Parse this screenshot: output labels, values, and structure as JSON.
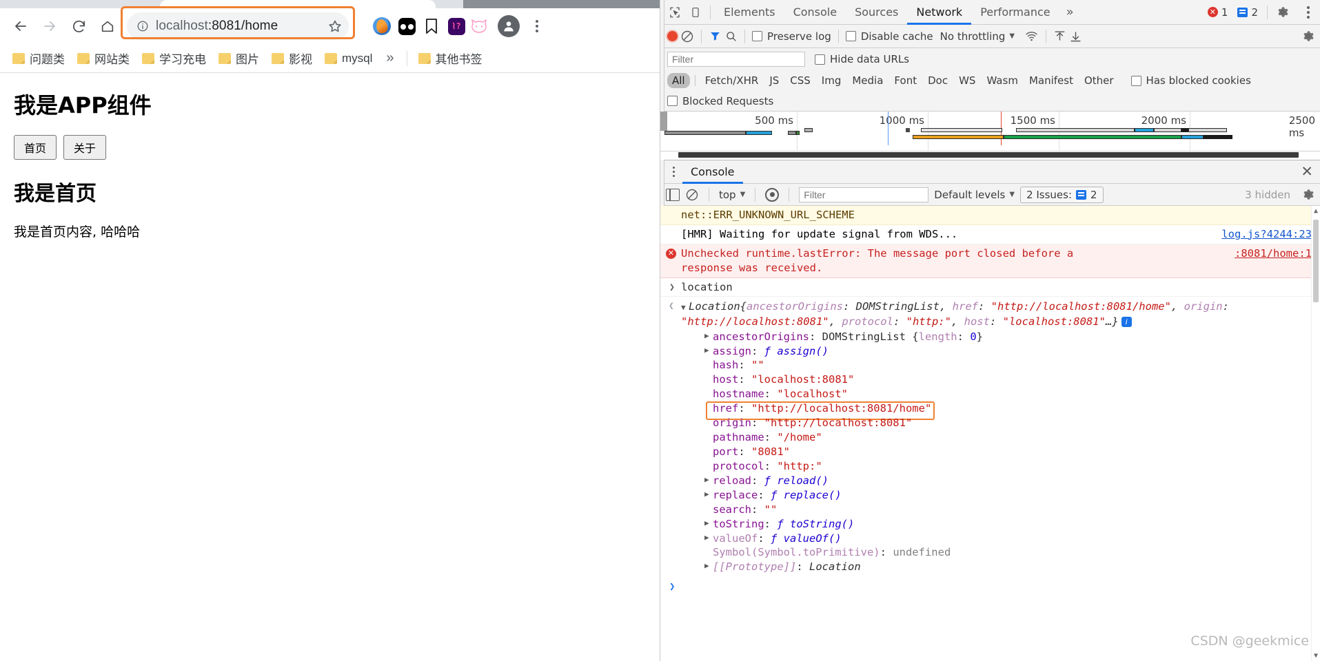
{
  "browser": {
    "nav": {
      "back": "back-arrow",
      "forward": "forward-arrow",
      "reload": "reload",
      "home": "home"
    },
    "omnibox": {
      "url_prefix": "localhost",
      "url_suffix": ":8081/home",
      "full_url": "localhost:8081/home",
      "highlight_color": "#f08030",
      "info_icon": "site-info-icon",
      "star_icon": "bookmark-star-icon"
    },
    "extensions": [
      "fire-extension-icon",
      "pocket-extension-icon",
      "bookmark-extension-icon",
      "purple-extension-icon",
      "cat-extension-icon"
    ],
    "bookmarks": [
      {
        "label": "问题类"
      },
      {
        "label": "网站类"
      },
      {
        "label": "学习充电"
      },
      {
        "label": "图片"
      },
      {
        "label": "影视"
      },
      {
        "label": "mysql"
      }
    ],
    "bookmarks_overflow": "»",
    "other_bookmarks": "其他书签",
    "page": {
      "title": "我是APP组件",
      "buttons": [
        "首页",
        "关于"
      ],
      "heading": "我是首页",
      "body": "我是首页内容, 哈哈哈"
    }
  },
  "devtools": {
    "tabs": [
      {
        "label": "Elements",
        "active": false
      },
      {
        "label": "Console",
        "active": false
      },
      {
        "label": "Sources",
        "active": false
      },
      {
        "label": "Network",
        "active": true
      },
      {
        "label": "Performance",
        "active": false
      }
    ],
    "more_tabs": "»",
    "error_count": "1",
    "message_count": "2",
    "network_toolbar": {
      "record": "record-button",
      "clear": "clear-button",
      "filter_icon": "funnel-icon",
      "search_icon": "search-icon",
      "preserve_log": "Preserve log",
      "disable_cache": "Disable cache",
      "throttling": "No throttling",
      "upload_icon": "import-har-icon",
      "download_icon": "export-har-icon",
      "settings_icon": "gear-icon"
    },
    "filter": {
      "placeholder": "Filter",
      "value": "",
      "hide_data_urls": "Hide data URLs",
      "has_blocked_cookies": "Has blocked cookies",
      "blocked_requests": "Blocked Requests"
    },
    "resource_types": [
      "All",
      "Fetch/XHR",
      "JS",
      "CSS",
      "Img",
      "Media",
      "Font",
      "Doc",
      "WS",
      "Wasm",
      "Manifest",
      "Other"
    ],
    "active_resource_type": "All",
    "overview": {
      "ticks": [
        "500 ms",
        "1000 ms",
        "1500 ms",
        "2000 ms",
        "2500 ms"
      ]
    },
    "drawer": {
      "tab": "Console",
      "close": "close-icon",
      "toolbar": {
        "sidebar_toggle": "console-sidebar-icon",
        "clear": "clear-console-icon",
        "context": "top",
        "eye": "live-expression-icon",
        "filter_placeholder": "Filter",
        "filter_value": "",
        "levels": "Default levels",
        "issues": "2 Issues:",
        "issues_count": "2",
        "hidden": "3 hidden",
        "settings": "gear-icon"
      },
      "messages": [
        {
          "kind": "warn",
          "text": "net::ERR_UNKNOWN_URL_SCHEME",
          "source": ""
        },
        {
          "kind": "info",
          "text": "[HMR] Waiting for update signal from WDS...",
          "source": "log.js?4244:23"
        },
        {
          "kind": "err",
          "text": "Unchecked runtime.lastError: The message port closed before a response was received.",
          "source": ":8081/home:1"
        }
      ],
      "evaluated": "location",
      "result_preview": {
        "class": "Location",
        "open_brace": "{",
        "parts": [
          {
            "key": "ancestorOrigins",
            "value": "DOMStringList",
            "type": "cls"
          },
          {
            "key": "href",
            "value": "\"http://localhost:8081/home\"",
            "type": "str"
          },
          {
            "key": "origin",
            "value": "\"http://localhost:8081\"",
            "type": "str"
          },
          {
            "key": "protocol",
            "value": "\"http:\"",
            "type": "str"
          },
          {
            "key": "host",
            "value": "\"localhost:8081\"",
            "type": "str"
          }
        ],
        "ellipsis": "…}",
        "info_badge": "i"
      },
      "properties": [
        {
          "tri": true,
          "key": "ancestorOrigins",
          "sep": ": ",
          "value": "DOMStringList {length: 0}",
          "vtype": "cls-num",
          "dim": false
        },
        {
          "tri": true,
          "key": "assign",
          "sep": ": ",
          "value": "ƒ assign()",
          "vtype": "fn",
          "dim": false
        },
        {
          "tri": false,
          "key": "hash",
          "sep": ": ",
          "value": "\"\"",
          "vtype": "str",
          "dim": false
        },
        {
          "tri": false,
          "key": "host",
          "sep": ": ",
          "value": "\"localhost:8081\"",
          "vtype": "str",
          "dim": false
        },
        {
          "tri": false,
          "key": "hostname",
          "sep": ": ",
          "value": "\"localhost\"",
          "vtype": "str",
          "dim": false
        },
        {
          "tri": false,
          "key": "href",
          "sep": ": ",
          "value": "\"http://localhost:8081/home\"",
          "vtype": "str",
          "dim": false,
          "highlight": true
        },
        {
          "tri": false,
          "key": "origin",
          "sep": ": ",
          "value": "\"http://localhost:8081\"",
          "vtype": "str",
          "dim": false
        },
        {
          "tri": false,
          "key": "pathname",
          "sep": ": ",
          "value": "\"/home\"",
          "vtype": "str",
          "dim": false
        },
        {
          "tri": false,
          "key": "port",
          "sep": ": ",
          "value": "\"8081\"",
          "vtype": "str",
          "dim": false
        },
        {
          "tri": false,
          "key": "protocol",
          "sep": ": ",
          "value": "\"http:\"",
          "vtype": "str",
          "dim": false
        },
        {
          "tri": true,
          "key": "reload",
          "sep": ": ",
          "value": "ƒ reload()",
          "vtype": "fn",
          "dim": false
        },
        {
          "tri": true,
          "key": "replace",
          "sep": ": ",
          "value": "ƒ replace()",
          "vtype": "fn",
          "dim": false
        },
        {
          "tri": false,
          "key": "search",
          "sep": ": ",
          "value": "\"\"",
          "vtype": "str",
          "dim": false
        },
        {
          "tri": true,
          "key": "toString",
          "sep": ": ",
          "value": "ƒ toString()",
          "vtype": "fn",
          "dim": false
        },
        {
          "tri": true,
          "key": "valueOf",
          "sep": ": ",
          "value": "ƒ valueOf()",
          "vtype": "fn",
          "dim": true
        },
        {
          "tri": false,
          "key": "Symbol(Symbol.toPrimitive)",
          "sep": ": ",
          "value": "undefined",
          "vtype": "undef",
          "dim": true
        },
        {
          "tri": true,
          "key": "[[Prototype]]",
          "sep": ": ",
          "value": "Location",
          "vtype": "plain",
          "dim": true,
          "italic": true
        }
      ],
      "prompt": ">",
      "watermark": "CSDN @geekmice"
    }
  }
}
